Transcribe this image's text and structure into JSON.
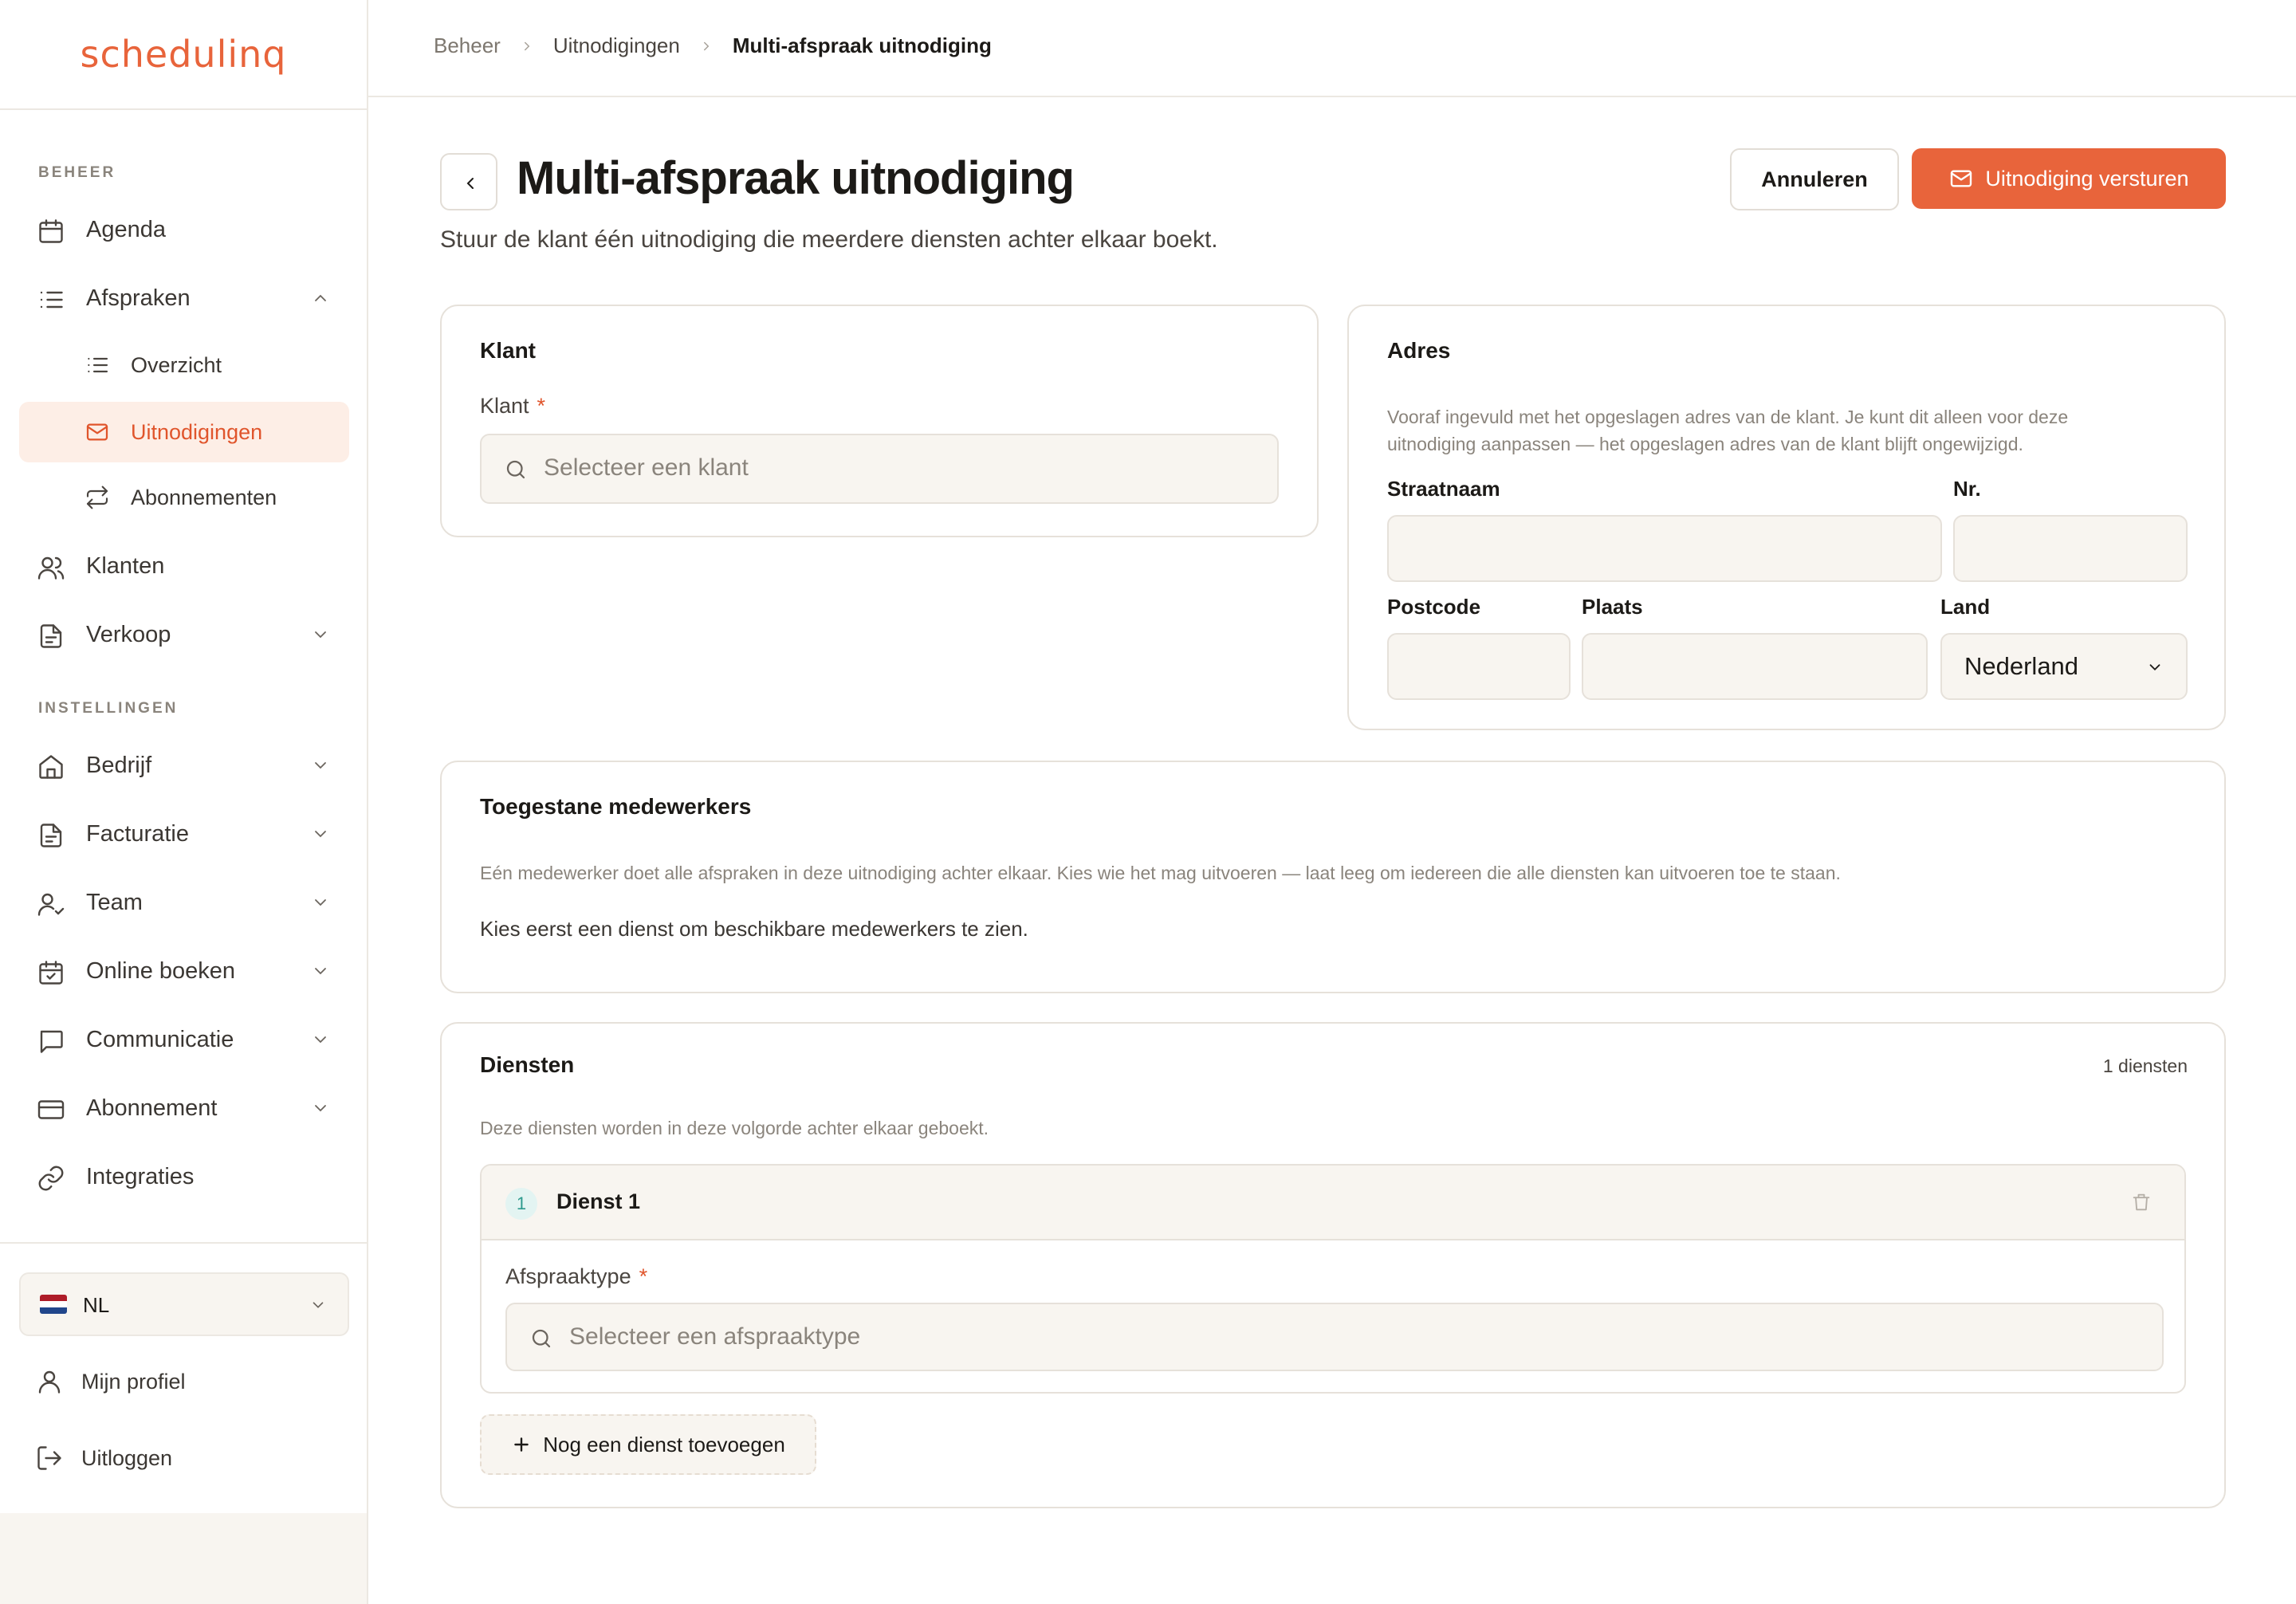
{
  "app": {
    "logo": "schedulinq"
  },
  "sidebar": {
    "section_beheer": "BEHEER",
    "section_instellingen": "INSTELLINGEN",
    "items": {
      "agenda": "Agenda",
      "afspraken": "Afspraken",
      "overzicht": "Overzicht",
      "uitnodigingen": "Uitnodigingen",
      "abonnementen": "Abonnementen",
      "klanten": "Klanten",
      "verkoop": "Verkoop",
      "bedrijf": "Bedrijf",
      "facturatie": "Facturatie",
      "team": "Team",
      "online_boeken": "Online boeken",
      "communicatie": "Communicatie",
      "abonnement": "Abonnement",
      "integraties": "Integraties"
    },
    "active_item": "uitnodigingen",
    "language": "NL",
    "profile": "Mijn profiel",
    "logout": "Uitloggen"
  },
  "breadcrumb": {
    "root": "Beheer",
    "parent": "Uitnodigingen",
    "current": "Multi-afspraak uitnodiging"
  },
  "header": {
    "title": "Multi-afspraak uitnodiging",
    "subtitle": "Stuur de klant één uitnodiging die meerdere diensten achter elkaar boekt.",
    "cancel_label": "Annuleren",
    "send_label": "Uitnodiging versturen"
  },
  "klant_card": {
    "title": "Klant",
    "field_label": "Klant",
    "required_mark": "*",
    "placeholder": "Selecteer een klant"
  },
  "adres_card": {
    "title": "Adres",
    "help_line1": "Vooraf ingevuld met het opgeslagen adres van de klant. Je kunt dit alleen voor deze",
    "help_line2": "uitnodiging aanpassen — het opgeslagen adres van de klant blijft ongewijzigd.",
    "straatnaam_label": "Straatnaam",
    "straatnaam_value": "",
    "nr_label": "Nr.",
    "nr_value": "",
    "postcode_label": "Postcode",
    "postcode_value": "",
    "plaats_label": "Plaats",
    "plaats_value": "",
    "land_label": "Land",
    "land_value": "Nederland"
  },
  "medewerkers_card": {
    "title": "Toegestane medewerkers",
    "help": "Eén medewerker doet alle afspraken in deze uitnodiging achter elkaar. Kies wie het mag uitvoeren — laat leeg om iedereen die alle diensten kan uitvoeren toe te staan.",
    "empty_text": "Kies eerst een dienst om beschikbare medewerkers te zien."
  },
  "diensten_card": {
    "title": "Diensten",
    "count_label": "1 diensten",
    "help": "Deze diensten worden in deze volgorde achter elkaar geboekt.",
    "items": [
      {
        "number": "1",
        "name": "Dienst 1",
        "field_label": "Afspraaktype",
        "required_mark": "*",
        "placeholder": "Selecteer een afspraaktype"
      }
    ],
    "add_label": "Nog een dienst toevoegen"
  },
  "colors": {
    "accent": "#e8643b",
    "active_bg": "#fdeee6",
    "input_bg": "#f8f5f0",
    "border": "#e6e1da",
    "badge_bg": "#e3f4f2",
    "badge_text": "#2e9a8e"
  },
  "icons": {
    "agenda": "calendar-icon",
    "afspraken": "list-icon",
    "overzicht": "list-icon",
    "uitnodigingen": "mail-icon",
    "abonnementen": "repeat-icon",
    "klanten": "users-icon",
    "verkoop": "document-icon",
    "bedrijf": "home-icon",
    "facturatie": "document-icon",
    "team": "user-check-icon",
    "online_boeken": "calendar-check-icon",
    "communicatie": "message-icon",
    "abonnement": "credit-card-icon",
    "integraties": "link-icon"
  }
}
